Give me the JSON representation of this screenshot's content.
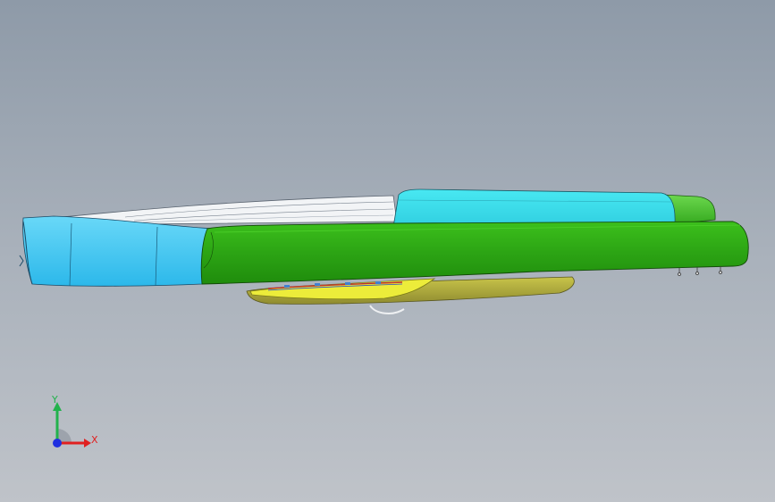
{
  "viewport": {
    "background_top": "#8e9aa8",
    "background_bottom": "#bfc3c9"
  },
  "model": {
    "parts": [
      {
        "name": "front-cover",
        "color": "#3ec8f0"
      },
      {
        "name": "top-panel",
        "color": "#3ddde8"
      },
      {
        "name": "main-body",
        "color": "#2ca414"
      },
      {
        "name": "lens-strip",
        "color": "#ecec3a"
      },
      {
        "name": "under-shell",
        "color": "#b8b43e"
      },
      {
        "name": "rear-cap",
        "color": "#52c43c"
      }
    ]
  },
  "triad": {
    "y_label": "Y",
    "x_label": "X",
    "y_color": "#22b24c",
    "x_color": "#e02020",
    "z_color": "#2030e0"
  }
}
